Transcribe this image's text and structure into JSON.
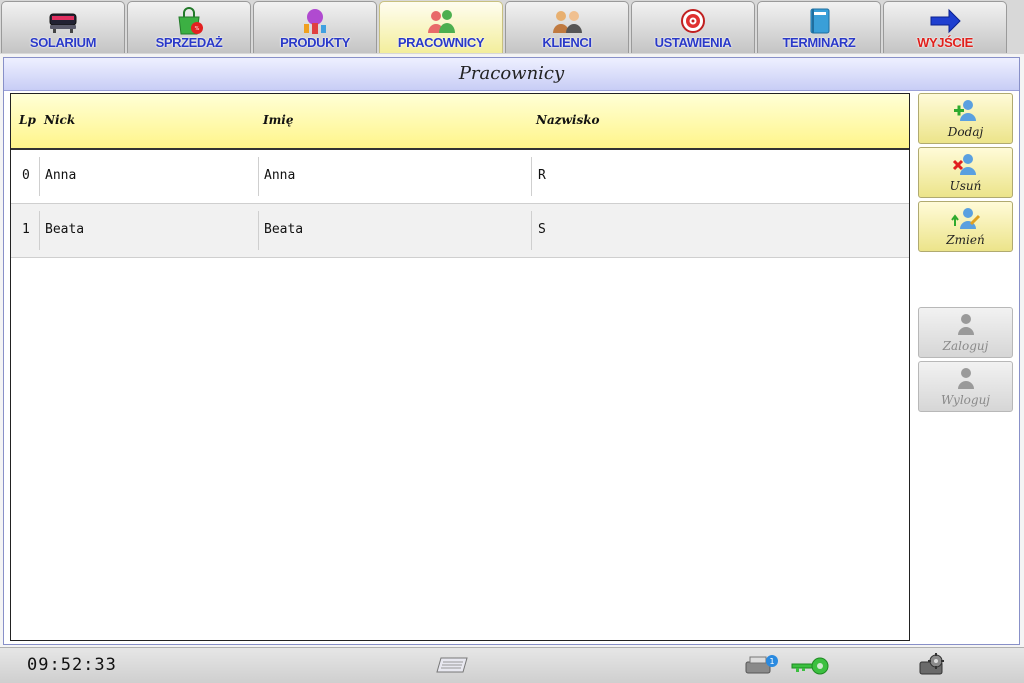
{
  "nav": {
    "tabs": [
      {
        "label": "SOLARIUM",
        "icon": "solarium-bed-icon",
        "active": false
      },
      {
        "label": "SPRZEDAŻ",
        "icon": "shopping-bag-icon",
        "active": false
      },
      {
        "label": "PRODUKTY",
        "icon": "products-icon",
        "active": false
      },
      {
        "label": "PRACOWNICY",
        "icon": "employees-icon",
        "active": true
      },
      {
        "label": "KLIENCI",
        "icon": "clients-icon",
        "active": false
      },
      {
        "label": "USTAWIENIA",
        "icon": "settings-target-icon",
        "active": false
      },
      {
        "label": "TERMINARZ",
        "icon": "planner-book-icon",
        "active": false
      },
      {
        "label": "WYJŚCIE",
        "icon": "exit-arrow-icon",
        "active": false
      }
    ]
  },
  "window": {
    "title": "Pracownicy"
  },
  "table": {
    "columns": [
      "Lp",
      "Nick",
      "Imię",
      "Nazwisko"
    ],
    "rows": [
      {
        "lp": "0",
        "nick": "Anna",
        "imie": "Anna",
        "nazwisko": "R"
      },
      {
        "lp": "1",
        "nick": "Beata",
        "imie": "Beata",
        "nazwisko": "S"
      }
    ]
  },
  "actions": {
    "add": "Dodaj",
    "remove": "Usuń",
    "edit": "Zmień",
    "login": "Zaloguj",
    "logout": "Wyloguj"
  },
  "status": {
    "clock": "09:52:33",
    "icons": [
      "keyboard-icon",
      "printer-icon",
      "key-icon",
      "gear-icon"
    ]
  },
  "colors": {
    "tab_label": "#2a39c8",
    "exit_label": "#e0201c",
    "header_yellow": "#fff58a",
    "button_yellow": "#ece48a",
    "title_bar": "#c8cdf5"
  }
}
